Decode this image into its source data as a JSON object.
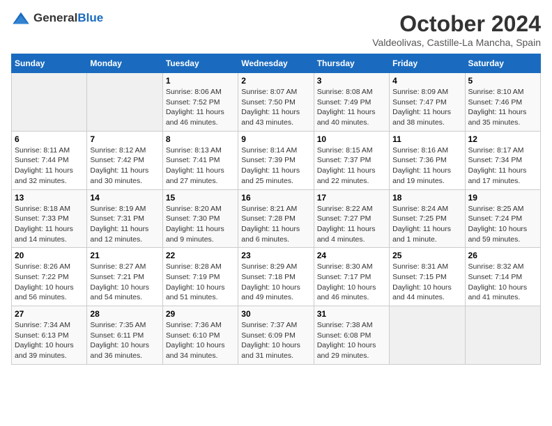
{
  "header": {
    "logo_general": "General",
    "logo_blue": "Blue",
    "month": "October 2024",
    "location": "Valdeolivas, Castille-La Mancha, Spain"
  },
  "weekdays": [
    "Sunday",
    "Monday",
    "Tuesday",
    "Wednesday",
    "Thursday",
    "Friday",
    "Saturday"
  ],
  "weeks": [
    [
      {
        "day": "",
        "info": ""
      },
      {
        "day": "",
        "info": ""
      },
      {
        "day": "1",
        "info": "Sunrise: 8:06 AM\nSunset: 7:52 PM\nDaylight: 11 hours and 46 minutes."
      },
      {
        "day": "2",
        "info": "Sunrise: 8:07 AM\nSunset: 7:50 PM\nDaylight: 11 hours and 43 minutes."
      },
      {
        "day": "3",
        "info": "Sunrise: 8:08 AM\nSunset: 7:49 PM\nDaylight: 11 hours and 40 minutes."
      },
      {
        "day": "4",
        "info": "Sunrise: 8:09 AM\nSunset: 7:47 PM\nDaylight: 11 hours and 38 minutes."
      },
      {
        "day": "5",
        "info": "Sunrise: 8:10 AM\nSunset: 7:46 PM\nDaylight: 11 hours and 35 minutes."
      }
    ],
    [
      {
        "day": "6",
        "info": "Sunrise: 8:11 AM\nSunset: 7:44 PM\nDaylight: 11 hours and 32 minutes."
      },
      {
        "day": "7",
        "info": "Sunrise: 8:12 AM\nSunset: 7:42 PM\nDaylight: 11 hours and 30 minutes."
      },
      {
        "day": "8",
        "info": "Sunrise: 8:13 AM\nSunset: 7:41 PM\nDaylight: 11 hours and 27 minutes."
      },
      {
        "day": "9",
        "info": "Sunrise: 8:14 AM\nSunset: 7:39 PM\nDaylight: 11 hours and 25 minutes."
      },
      {
        "day": "10",
        "info": "Sunrise: 8:15 AM\nSunset: 7:37 PM\nDaylight: 11 hours and 22 minutes."
      },
      {
        "day": "11",
        "info": "Sunrise: 8:16 AM\nSunset: 7:36 PM\nDaylight: 11 hours and 19 minutes."
      },
      {
        "day": "12",
        "info": "Sunrise: 8:17 AM\nSunset: 7:34 PM\nDaylight: 11 hours and 17 minutes."
      }
    ],
    [
      {
        "day": "13",
        "info": "Sunrise: 8:18 AM\nSunset: 7:33 PM\nDaylight: 11 hours and 14 minutes."
      },
      {
        "day": "14",
        "info": "Sunrise: 8:19 AM\nSunset: 7:31 PM\nDaylight: 11 hours and 12 minutes."
      },
      {
        "day": "15",
        "info": "Sunrise: 8:20 AM\nSunset: 7:30 PM\nDaylight: 11 hours and 9 minutes."
      },
      {
        "day": "16",
        "info": "Sunrise: 8:21 AM\nSunset: 7:28 PM\nDaylight: 11 hours and 6 minutes."
      },
      {
        "day": "17",
        "info": "Sunrise: 8:22 AM\nSunset: 7:27 PM\nDaylight: 11 hours and 4 minutes."
      },
      {
        "day": "18",
        "info": "Sunrise: 8:24 AM\nSunset: 7:25 PM\nDaylight: 11 hours and 1 minute."
      },
      {
        "day": "19",
        "info": "Sunrise: 8:25 AM\nSunset: 7:24 PM\nDaylight: 10 hours and 59 minutes."
      }
    ],
    [
      {
        "day": "20",
        "info": "Sunrise: 8:26 AM\nSunset: 7:22 PM\nDaylight: 10 hours and 56 minutes."
      },
      {
        "day": "21",
        "info": "Sunrise: 8:27 AM\nSunset: 7:21 PM\nDaylight: 10 hours and 54 minutes."
      },
      {
        "day": "22",
        "info": "Sunrise: 8:28 AM\nSunset: 7:19 PM\nDaylight: 10 hours and 51 minutes."
      },
      {
        "day": "23",
        "info": "Sunrise: 8:29 AM\nSunset: 7:18 PM\nDaylight: 10 hours and 49 minutes."
      },
      {
        "day": "24",
        "info": "Sunrise: 8:30 AM\nSunset: 7:17 PM\nDaylight: 10 hours and 46 minutes."
      },
      {
        "day": "25",
        "info": "Sunrise: 8:31 AM\nSunset: 7:15 PM\nDaylight: 10 hours and 44 minutes."
      },
      {
        "day": "26",
        "info": "Sunrise: 8:32 AM\nSunset: 7:14 PM\nDaylight: 10 hours and 41 minutes."
      }
    ],
    [
      {
        "day": "27",
        "info": "Sunrise: 7:34 AM\nSunset: 6:13 PM\nDaylight: 10 hours and 39 minutes."
      },
      {
        "day": "28",
        "info": "Sunrise: 7:35 AM\nSunset: 6:11 PM\nDaylight: 10 hours and 36 minutes."
      },
      {
        "day": "29",
        "info": "Sunrise: 7:36 AM\nSunset: 6:10 PM\nDaylight: 10 hours and 34 minutes."
      },
      {
        "day": "30",
        "info": "Sunrise: 7:37 AM\nSunset: 6:09 PM\nDaylight: 10 hours and 31 minutes."
      },
      {
        "day": "31",
        "info": "Sunrise: 7:38 AM\nSunset: 6:08 PM\nDaylight: 10 hours and 29 minutes."
      },
      {
        "day": "",
        "info": ""
      },
      {
        "day": "",
        "info": ""
      }
    ]
  ]
}
